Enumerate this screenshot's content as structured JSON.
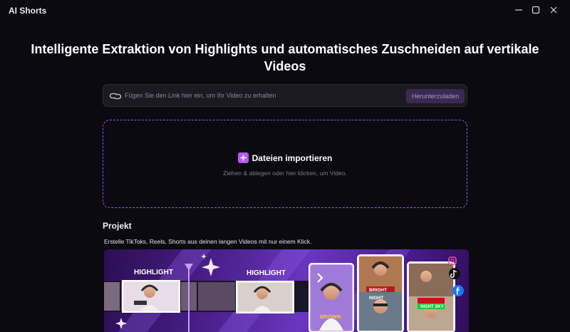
{
  "window": {
    "title": "AI Shorts",
    "controls": {
      "minimize_icon": "minimize-icon",
      "maximize_icon": "maximize-icon",
      "close_icon": "close-icon"
    }
  },
  "main": {
    "headline": "Intelligente Extraktion von Highlights und automatisches Zuschneiden auf vertikale Videos",
    "link_input": {
      "placeholder": "Fügen Sie den Link hier ein, um Ihr Video zu erhalten",
      "value": "",
      "icon": "link-icon"
    },
    "download_button": "Herunterzuladen",
    "dropzone": {
      "import_label": "Dateien importieren",
      "hint": "Ziehen & ablegen oder hier klicken, um Video."
    },
    "project": {
      "title": "Projekt",
      "subtitle": "Erstelle TikToks, Reels, Shorts aus deinen langen Videos mit nur einem Klick.",
      "banner": {
        "highlight_1": "HIGHLIGHT",
        "highlight_2": "HIGHLIGHT",
        "caption_brown": "BROWN",
        "caption_bright": "BRIGHT",
        "caption_night": "NIGHT",
        "caption_night_sky": "NIGHT SKY",
        "social_icons": [
          "instagram-icon",
          "tiktok-icon",
          "facebook-icon"
        ]
      }
    }
  },
  "colors": {
    "background": "#0b0a10",
    "accent": "#b558f0",
    "dashed_border": "#9a55e8",
    "button_bg": "#3a2a52",
    "caption_yellow": "#f5d60a",
    "caption_green": "#29c23a"
  }
}
